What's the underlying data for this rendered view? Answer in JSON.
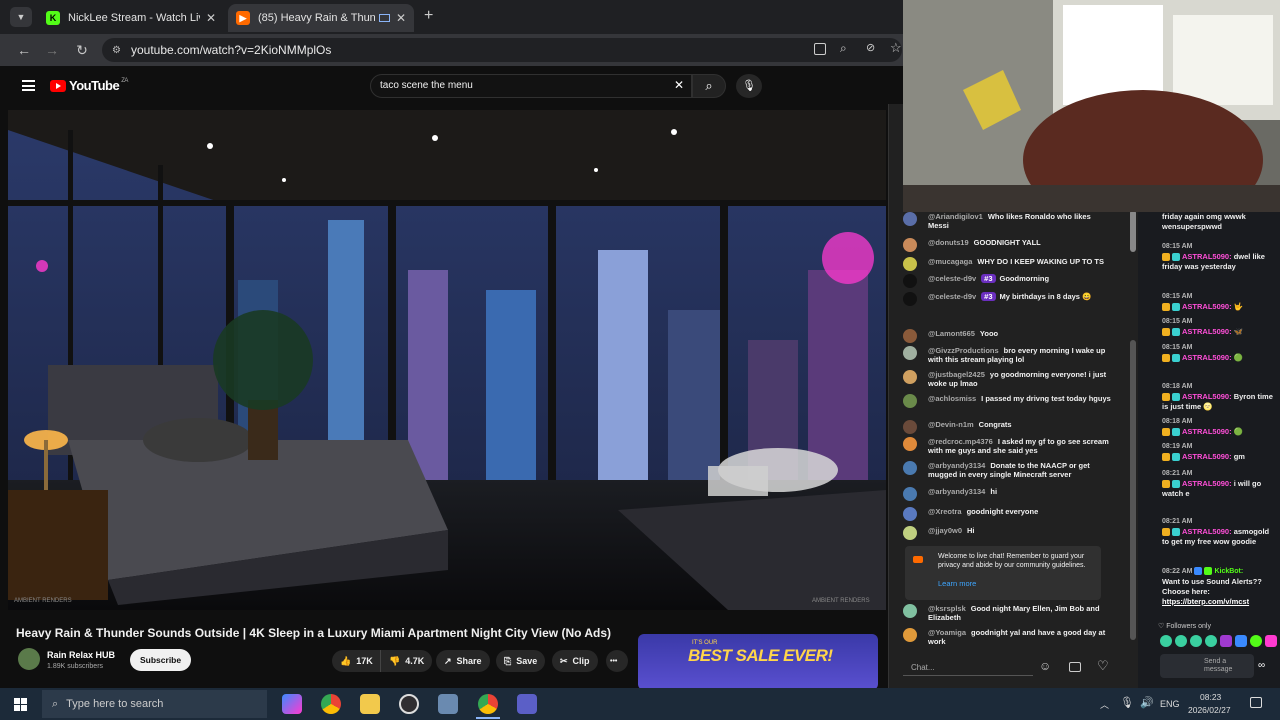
{
  "browser": {
    "tabs": [
      {
        "title": "NickLee Stream - Watch Live on",
        "icon": "kick-logo-icon",
        "active": false
      },
      {
        "title": "(85) Heavy Rain & Thunder",
        "icon": "youtube-logo-icon",
        "active": true
      }
    ],
    "new_tab_glyph": "+",
    "close_glyph": "✕",
    "url": "youtube.com/watch?v=2KioNMMplOs"
  },
  "youtube": {
    "logo_text": "YouTube",
    "country_code": "ZA",
    "search_value": "taco scene the menu",
    "video": {
      "watermark_left": "AMBIENT RENDERS",
      "watermark_right": "AMBIENT RENDERS"
    },
    "title": "Heavy Rain & Thunder Sounds Outside | 4K Sleep in a Luxury Miami Apartment Night City View (No Ads)",
    "channel": "Rain Relax HUB",
    "subscribers": "1.89K subscribers",
    "subscribe_label": "Subscribe",
    "likes": "17K",
    "dislikes": "4.7K",
    "share_label": "Share",
    "save_label": "Save",
    "clip_label": "Clip",
    "more_glyph": "•••",
    "ad": {
      "line1": "IT'S OUR",
      "line2": "BEST SALE EVER!"
    }
  },
  "live_chat": {
    "messages": [
      {
        "author": "@Ariandigilov1",
        "text": "Who likes Ronaldo who likes Messi",
        "color": "#5a6ea8"
      },
      {
        "author": "@donuts19",
        "text": "GOODNIGHT YALL",
        "color": "#c98a5a"
      },
      {
        "author": "@mucagaga",
        "text": "WHY DO I KEEP WAKING UP TO TS",
        "color": "#c9c24a"
      },
      {
        "author": "@celeste-d9v",
        "badge": "#3",
        "text": "Goodmorning",
        "color": "#111111"
      },
      {
        "author": "@celeste-d9v",
        "badge": "#3",
        "text": "My birthdays in 8 days 😀",
        "color": "#111111"
      },
      {
        "author": "@Lamont665",
        "text": "Yooo",
        "color": "#8a5a3a"
      },
      {
        "author": "@GivzzProductions",
        "text": "bro every morning I wake up with this stream playing lol",
        "color": "#a0b0a0"
      },
      {
        "author": "@justbagel2425",
        "text": "yo goodmorning everyone! i just woke up lmao",
        "color": "#d0a060"
      },
      {
        "author": "@achlosmiss",
        "text": "I passed my drivng test today hguys",
        "color": "#6a8a4a"
      },
      {
        "author": "@Devin-n1m",
        "text": "Congrats",
        "color": "#6a4a3a"
      },
      {
        "author": "@redcroc.mp4376",
        "text": "I asked my gf to go see scream with me guys and she said yes",
        "color": "#e08a3a"
      },
      {
        "author": "@arbyandy3134",
        "text": "Donate to the NAACP or get mugged in every single Minecraft server",
        "color": "#4a7ab0"
      },
      {
        "author": "@arbyandy3134",
        "text": "hi",
        "color": "#4a7ab0"
      },
      {
        "author": "@Xreotra",
        "text": "goodnight everyone",
        "color": "#5a7ac0"
      },
      {
        "author": "@jjay0w0",
        "text": "Hi",
        "color": "#c0d080"
      }
    ],
    "notice_text": "Welcome to live chat! Remember to guard your privacy and abide by our community guidelines.",
    "notice_link": "Learn more",
    "late_messages": [
      {
        "author": "@ksrsplsk",
        "text": "Good night Mary Ellen, Jim Bob and Elizabeth",
        "color": "#80c0a0"
      },
      {
        "author": "@Yoamiga",
        "text": "goodnight yal and have a good day at work",
        "color": "#e09a3a"
      }
    ],
    "input_placeholder": "Chat..."
  },
  "kick_chat": {
    "messages": [
      {
        "time": "",
        "user": "",
        "text": "friday again omg wwwk wensuperspwwd"
      },
      {
        "time": "08:15 AM",
        "user": "ASTRAL5090:",
        "text": "dwel like friday was yesterday"
      },
      {
        "time": "08:15 AM",
        "user": "ASTRAL5090:",
        "text": "🤟"
      },
      {
        "time": "08:15 AM",
        "user": "ASTRAL5090:",
        "text": "🦋"
      },
      {
        "time": "08:15 AM",
        "user": "ASTRAL5090:",
        "text": "🟢"
      },
      {
        "time": "08:18 AM",
        "user": "ASTRAL5090:",
        "text": "Byron time is just time 🌝"
      },
      {
        "time": "08:18 AM",
        "user": "ASTRAL5090:",
        "text": "🟢"
      },
      {
        "time": "08:19 AM",
        "user": "ASTRAL5090:",
        "text": "gm"
      },
      {
        "time": "08:21 AM",
        "user": "ASTRAL5090:",
        "text": "i will go watch e"
      },
      {
        "time": "08:21 AM",
        "user": "ASTRAL5090:",
        "text": "asmogold to get my free wow goodie"
      }
    ],
    "bot_time": "08:22 AM",
    "bot_user": "KickBot:",
    "bot_text": "Want to use Sound Alerts?? Choose here:",
    "bot_link": "https://bterp.com/v/mcst",
    "followers_only": "Followers only",
    "send_placeholder": "Send a message"
  },
  "taskbar": {
    "search_placeholder": "Type here to search",
    "language": "ENG",
    "time": "08:23",
    "date": "2026/02/27"
  }
}
